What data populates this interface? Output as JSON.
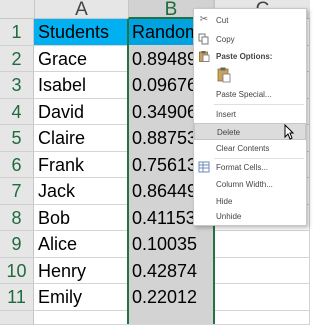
{
  "columns": [
    "A",
    "B",
    "C"
  ],
  "rows": [
    "1",
    "2",
    "3",
    "4",
    "5",
    "6",
    "7",
    "8",
    "9",
    "10",
    "11"
  ],
  "table": {
    "header": {
      "name": "Students",
      "value": "Random"
    },
    "rows": [
      {
        "name": "Grace",
        "value": "0.89489"
      },
      {
        "name": "Isabel",
        "value": "0.09676"
      },
      {
        "name": "David",
        "value": "0.34906"
      },
      {
        "name": "Claire",
        "value": "0.88753"
      },
      {
        "name": "Frank",
        "value": "0.75613"
      },
      {
        "name": "Jack",
        "value": "0.86449"
      },
      {
        "name": "Bob",
        "value": "0.41153"
      },
      {
        "name": "Alice",
        "value": "0.10035"
      },
      {
        "name": "Henry",
        "value": "0.42874"
      },
      {
        "name": "Emily",
        "value": "0.22012"
      }
    ]
  },
  "context_menu": {
    "cut": "Cut",
    "copy": "Copy",
    "paste_options": "Paste Options:",
    "paste_special": "Paste Special...",
    "insert": "Insert",
    "delete": "Delete",
    "clear_contents": "Clear Contents",
    "format_cells": "Format Cells...",
    "column_width": "Column Width...",
    "hide": "Hide",
    "unhide": "Unhide"
  },
  "colors": {
    "header_fill": "#00b0f0",
    "selection_fill": "#d3d3d3",
    "excel_green": "#217346"
  }
}
